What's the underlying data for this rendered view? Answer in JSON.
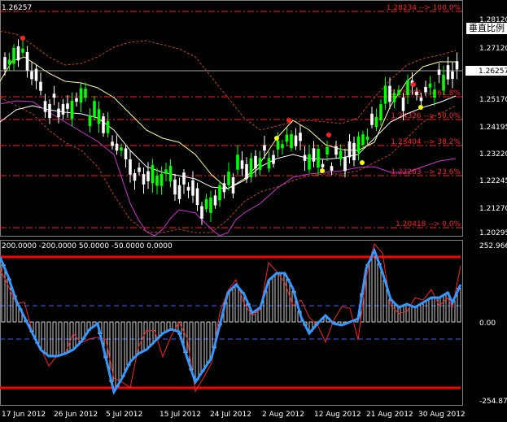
{
  "main": {
    "symbol_price": "1.26257",
    "price_labels": [
      "1.28120",
      "1.27120",
      "1.26257",
      "1.25170",
      "1.24195",
      "1.23220",
      "1.22245",
      "1.21270",
      "1.20295"
    ],
    "current_price": "1.26257",
    "scale_button": "垂直比例",
    "fib_levels": [
      {
        "label": "1.28234 --> 100.0%"
      },
      {
        "label": "1.25248 --> 61.8%"
      },
      {
        "label": "1.24326 --> 50.0%"
      },
      {
        "label": "1.23404 --> 38.2%"
      },
      {
        "label": "1.22263 --> 23.6%"
      },
      {
        "label": "1.20418 --> 0.0%"
      }
    ],
    "colors": {
      "bull": "#00ff00",
      "bear": "#ffffff",
      "bands": "#c04020",
      "ma": "#ffff90",
      "envelope": "#d030d0",
      "fib": "#ff2020"
    }
  },
  "osc": {
    "header": "200.0000 -200.0000 50.0000 -50.0000 0.0000",
    "labels": [
      "252.966",
      "0.00",
      "-254.875"
    ],
    "colors": {
      "main": "#3399ff",
      "signal": "#ff2020",
      "bounds": "#ff0000",
      "hist": "#ffffff"
    }
  },
  "x_axis": {
    "labels": [
      "17 Jun 2012",
      "26 Jun 2012",
      "5 Jul 2012",
      "15 Jul 2012",
      "24 Jul 2012",
      "2 Aug 2012",
      "12 Aug 2012",
      "21 Aug 2012",
      "30 Aug 2012"
    ]
  }
}
